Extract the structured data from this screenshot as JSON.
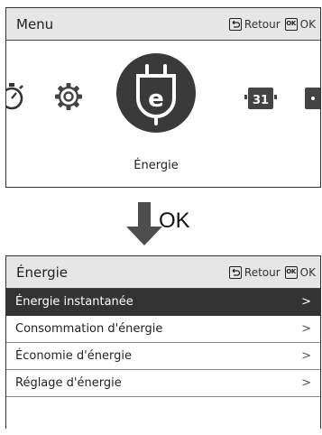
{
  "menu_panel": {
    "title": "Menu",
    "back_label": "Retour",
    "ok_icon_text": "OK",
    "ok_label": "OK",
    "selected_item_label": "Énergie",
    "selected_item_letter": "e",
    "calendar_day": "31"
  },
  "transition": {
    "label": "OK"
  },
  "energy_panel": {
    "title": "Énergie",
    "back_label": "Retour",
    "ok_icon_text": "OK",
    "ok_label": "OK",
    "items": [
      {
        "label": "Énergie instantanée",
        "chevron": ">",
        "selected": true
      },
      {
        "label": "Consommation d'énergie",
        "chevron": ">",
        "selected": false
      },
      {
        "label": "Économie d'énergie",
        "chevron": ">",
        "selected": false
      },
      {
        "label": "Réglage d'énergie",
        "chevron": ">",
        "selected": false
      }
    ]
  },
  "colors": {
    "header_bg": "#e6e6e6",
    "selected_row_bg": "#333333",
    "icon_dark": "#3a3a3a"
  }
}
